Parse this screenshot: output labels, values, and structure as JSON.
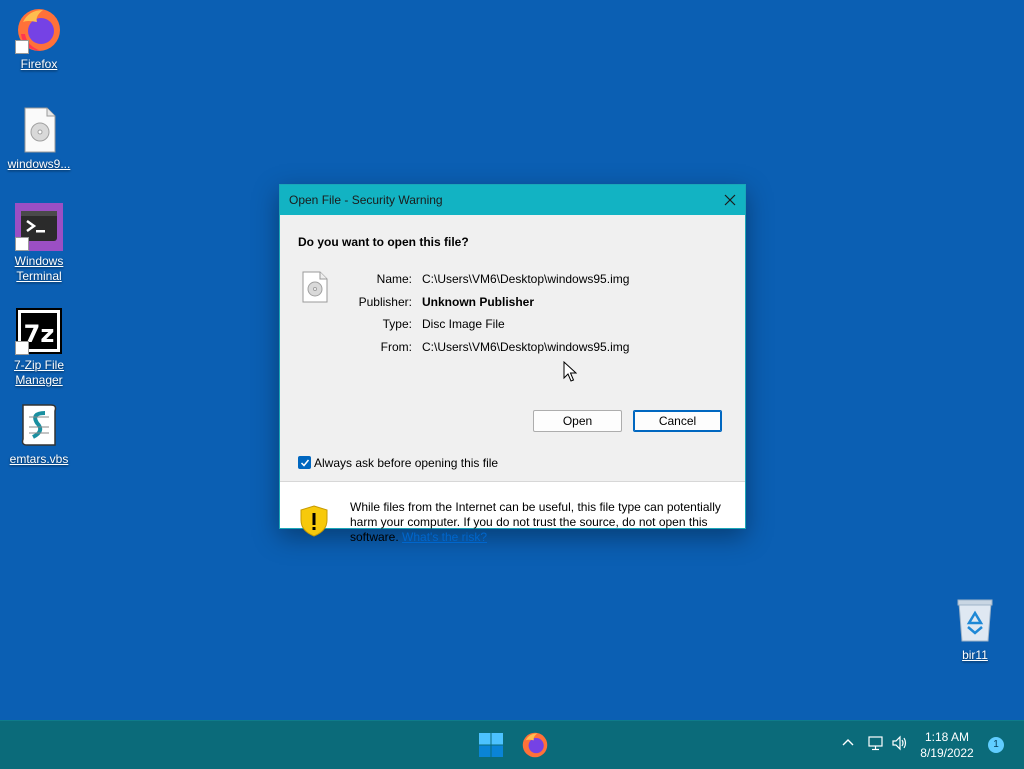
{
  "desktop": {
    "icons": [
      {
        "label": "Firefox"
      },
      {
        "label": "windows9..."
      },
      {
        "label": "Windows Terminal"
      },
      {
        "label": "7-Zip File Manager"
      },
      {
        "label": "emtars.vbs"
      },
      {
        "label": "bir11"
      }
    ]
  },
  "dialog": {
    "title": "Open File - Security Warning",
    "question": "Do you want to open this file?",
    "props": {
      "name_label": "Name:",
      "name_value": "C:\\Users\\VM6\\Desktop\\windows95.img",
      "publisher_label": "Publisher:",
      "publisher_value": "Unknown Publisher",
      "type_label": "Type:",
      "type_value": "Disc Image File",
      "from_label": "From:",
      "from_value": "C:\\Users\\VM6\\Desktop\\windows95.img"
    },
    "open_label": "Open",
    "cancel_label": "Cancel",
    "checkbox_label": "Always ask before opening this file",
    "checkbox_checked": true,
    "warning_text": "While files from the Internet can be useful, this file type can potentially harm your computer. If you do not trust the source, do not open this software.",
    "risk_link": "What's the risk?"
  },
  "taskbar": {
    "time": "1:18 AM",
    "date": "8/19/2022",
    "notification_count": "1"
  },
  "colors": {
    "desktop_bg": "#0b5fb3",
    "taskbar_bg": "#0b6b7a",
    "titlebar_bg": "#12b3c3",
    "accent": "#0067c0"
  }
}
